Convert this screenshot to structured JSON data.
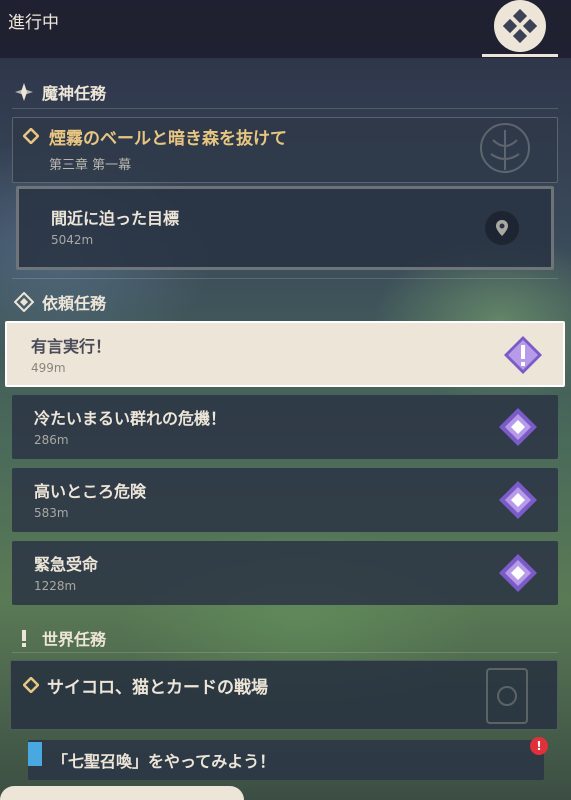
{
  "header": {
    "title": "進行中"
  },
  "sections": {
    "archon": "魔神任務",
    "commission": "依頼任務",
    "world": "世界任務"
  },
  "archon_quest": {
    "title": "煙霧のベールと暗き森を抜けて",
    "chapter": "第三章 第一幕",
    "objective": {
      "title": "間近に迫った目標",
      "distance": "5042m"
    }
  },
  "commissions": [
    {
      "title": "有言実行！",
      "distance": "499m",
      "selected": true
    },
    {
      "title": "冷たいまるい群れの危機！",
      "distance": "286m"
    },
    {
      "title": "高いところ危険",
      "distance": "583m"
    },
    {
      "title": "緊急受命",
      "distance": "1228m"
    }
  ],
  "world_quest": {
    "title": "サイコロ、猫とカードの戦場",
    "objective": "「七聖召喚」をやってみよう！"
  },
  "colors": {
    "accent": "#e8c682",
    "panel": "#2c3444",
    "selected": "#ece5d8",
    "commission_icon": "#7b5bc8"
  }
}
